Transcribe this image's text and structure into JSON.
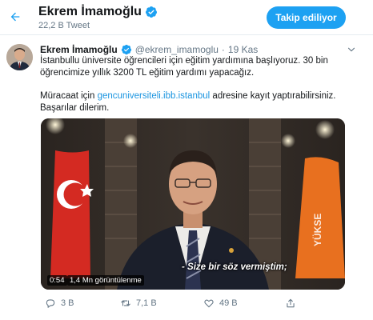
{
  "header": {
    "name": "Ekrem İmamoğlu",
    "tweet_count": "22,2 B Tweet",
    "follow_label": "Takip ediliyor"
  },
  "tweet": {
    "author": "Ekrem İmamoğlu",
    "handle": "@ekrem_imamoglu",
    "separator": "·",
    "date": "19 Kas",
    "line1": "İstanbullu üniversite öğrencileri için eğitim yardımına başlıyoruz. 30 bin öğrencimize yıllık 3200 TL eğitim yardımı yapacağız.",
    "line2_prefix": "Müracaat için ",
    "link": "gencuniversiteli.ibb.istanbul",
    "line2_suffix": "  adresine kayıt yaptırabilirsiniz. Başarılar dilerim."
  },
  "video": {
    "subtitle": "- Size bir söz vermiştim;",
    "duration": "0:54",
    "views": "1,4 Mn görüntülenme"
  },
  "actions": {
    "replies": "3 B",
    "retweets": "7,1 B",
    "likes": "49 B"
  },
  "icons": {
    "back": "arrow-left-icon",
    "verified": "verified-badge-icon",
    "caret": "chevron-down-icon",
    "reply": "reply-icon",
    "retweet": "retweet-icon",
    "like": "heart-icon",
    "share": "share-icon"
  },
  "colors": {
    "accent": "#1da1f2",
    "link": "#1b95e0",
    "muted": "#657786",
    "text": "#14171a"
  }
}
